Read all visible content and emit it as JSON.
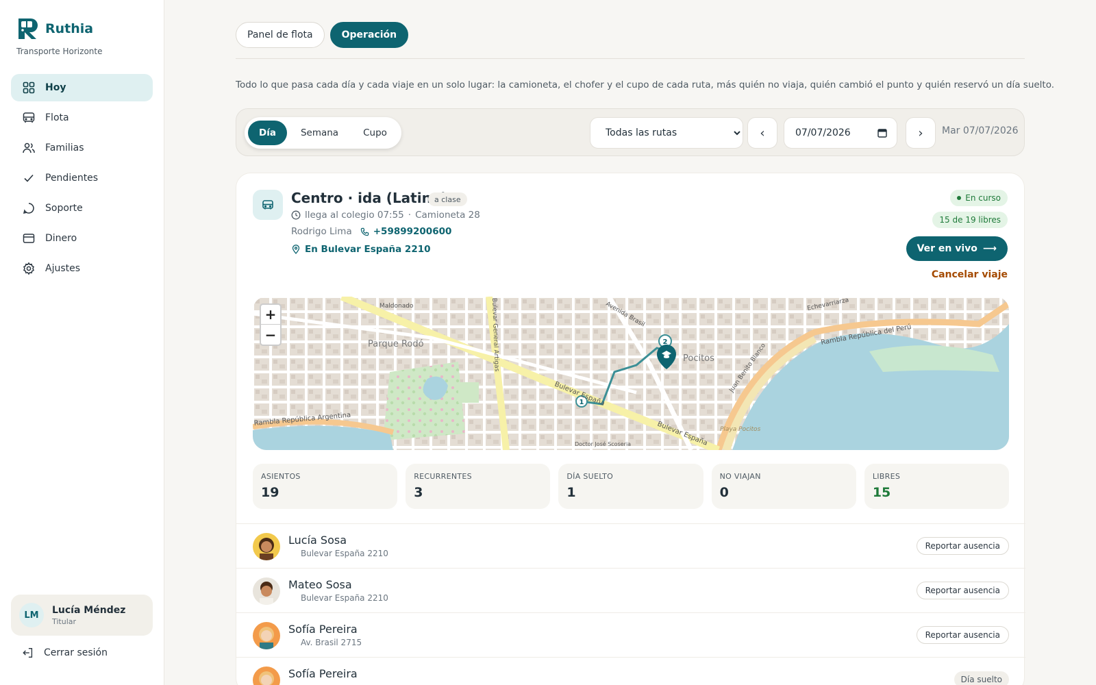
{
  "brand": {
    "name": "Ruthia",
    "subtitle": "Transporte Horizonte",
    "accent": "#0e6470"
  },
  "sidebar": {
    "items": [
      {
        "label": "Hoy",
        "icon": "grid-icon",
        "active": true
      },
      {
        "label": "Flota",
        "icon": "bus-icon"
      },
      {
        "label": "Familias",
        "icon": "users-icon"
      },
      {
        "label": "Pendientes",
        "icon": "check-icon"
      },
      {
        "label": "Soporte",
        "icon": "chat-icon"
      },
      {
        "label": "Dinero",
        "icon": "card-icon"
      },
      {
        "label": "Ajustes",
        "icon": "gear-icon"
      }
    ],
    "user": {
      "initials": "LM",
      "name": "Lucía Méndez",
      "role": "Titular"
    },
    "logout_label": "Cerrar sesión"
  },
  "top_tabs": [
    {
      "label": "Panel de flota",
      "active": false
    },
    {
      "label": "Operación",
      "active": true
    }
  ],
  "intro": "Todo lo que pasa cada día y cada viaje en un solo lugar: la camioneta, el chofer y el cupo de cada ruta, más quién no viaja, quién cambió el punto y quién reservó un día suelto.",
  "toolbar": {
    "views": [
      {
        "label": "Día",
        "active": true
      },
      {
        "label": "Semana",
        "active": false
      },
      {
        "label": "Cupo",
        "active": false
      }
    ],
    "route_selected": "Todas las rutas",
    "prev_label": "‹",
    "next_label": "›",
    "date_value": "07/07/2026",
    "date_label": "Mar 07/07/2026"
  },
  "trip": {
    "title": "Centro · ida (Latino)",
    "tag": "a clase",
    "arrival": "llega al colegio 07:55",
    "separator": "·",
    "vehicle": "Camioneta 28",
    "driver": "Rodrigo Lima",
    "phone": "+59899200600",
    "location": "En Bulevar España 2210",
    "status": "En curso",
    "seats_free": "15 de 19 libres",
    "live_label": "Ver en vivo",
    "live_arrow": "⟶",
    "cancel_label": "Cancelar viaje"
  },
  "map": {
    "zoom_in": "+",
    "zoom_out": "−",
    "labels": {
      "parque_rodo": "Parque Rodó",
      "pocitos": "Pocitos",
      "bulevar_espana": "Bulevar España",
      "bulevar_artigas": "Bulevar General Artigas",
      "rambla_argentina": "Rambla República Argentina",
      "rambla_peru": "Rambla República del Perú",
      "avenida_brasil": "Avenida Brasil",
      "maldonado": "Maldonado",
      "playa_pocitos": "Playa Pocitos",
      "juan_benito_blanco": "Juan Benito Blanco",
      "echevarriarza": "Echevarriarza",
      "jose_scoseria": "Doctor José Scoseria"
    },
    "stops": [
      "1",
      "2"
    ],
    "route_color": "#3b8f96",
    "water_color": "#aad3df"
  },
  "stats": [
    {
      "label": "ASIENTOS",
      "value": "19"
    },
    {
      "label": "RECURRENTES",
      "value": "3"
    },
    {
      "label": "DÍA SUELTO",
      "value": "1"
    },
    {
      "label": "NO VIAJAN",
      "value": "0"
    },
    {
      "label": "LIBRES",
      "value": "15",
      "highlight": true
    }
  ],
  "passengers": [
    {
      "name": "Lucía Sosa",
      "address": "Bulevar España 2210",
      "action": "Reportar ausencia",
      "avatar_bg": "#f2c94c"
    },
    {
      "name": "Mateo Sosa",
      "address": "Bulevar España 2210",
      "action": "Reportar ausencia",
      "avatar_bg": "#e8e4dc"
    },
    {
      "name": "Sofía Pereira",
      "address": "Av. Brasil 2715",
      "action": "Reportar ausencia",
      "avatar_bg": "#f39b4a"
    },
    {
      "name": "Sofía Pereira",
      "address": "",
      "tag": "Día suelto",
      "avatar_bg": "#f39b4a"
    }
  ]
}
